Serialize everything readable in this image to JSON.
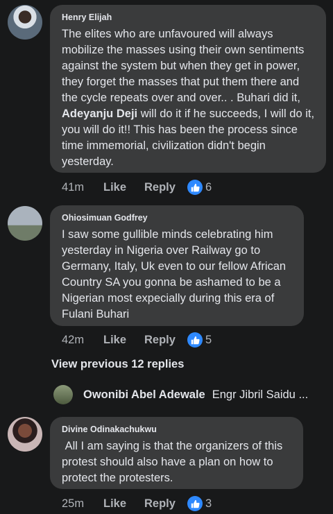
{
  "comments": [
    {
      "name": "Henry Elijah",
      "text_before": "The elites who are unfavoured will always mobilize the masses using their own sentiments against the system but when they get in power, they forget the masses that put them there and the cycle repeats over and over.. . Buhari did it, ",
      "text_bold": "Adeyanju Deji",
      "text_after": " will do it if he succeeds, I will do it, you will do it!! This has been the process since time immemorial, civilization didn't begin yesterday.",
      "time": "41m",
      "like_label": "Like",
      "reply_label": "Reply",
      "reaction_count": "6"
    },
    {
      "name": "Ohiosimuan Godfrey",
      "text": "I saw some gullible minds celebrating him yesterday in Nigeria over Railway go to Germany, Italy, Uk even to our fellow African Country SA  you gonna be ashamed to be a Nigerian most expecially during this era of Fulani Buhari",
      "time": "42m",
      "like_label": "Like",
      "reply_label": "Reply",
      "reaction_count": "5"
    },
    {
      "name": "Divine Odinakachukwu",
      "text": " All I am saying is that the organizers of this protest should also have a plan on how to protect the protesters.",
      "time": "25m",
      "like_label": "Like",
      "reply_label": "Reply",
      "reaction_count": "3"
    }
  ],
  "view_previous": "View previous 12 replies",
  "reply_preview": {
    "name": "Owonibi Abel Adewale",
    "snippet": "Engr Jibril Saidu ..."
  },
  "colors": {
    "background": "#18191a",
    "bubble": "#3a3b3c",
    "like_blue": "#2e89ff",
    "secondary_text": "#b0b3b8"
  },
  "icons": [
    "avatar",
    "thumbs-up-icon"
  ]
}
